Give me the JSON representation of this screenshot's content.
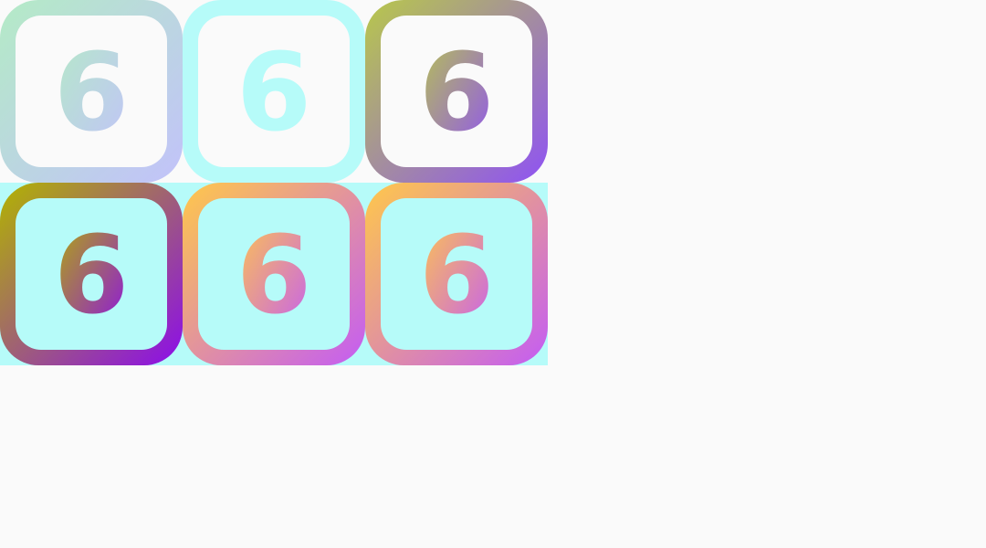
{
  "colors": {
    "page_background": "#fafafa",
    "row_backgrounds": [
      "#fafafa",
      "#b6fbf9"
    ],
    "tile_fill": "#fafafa",
    "tile_fill_dark": "#b6fbf9"
  },
  "tiles": [
    {
      "label": "6",
      "icon": "digit-six-icon",
      "gradient": [
        "#b4ebc6",
        "#c2c2fa"
      ]
    },
    {
      "label": "6",
      "icon": "digit-six-icon",
      "gradient": [
        "#b6fbf9",
        "#b6fbf9"
      ]
    },
    {
      "label": "6",
      "icon": "digit-six-icon",
      "gradient": [
        "#b8c84a",
        "#8f52f4"
      ]
    },
    {
      "label": "6",
      "icon": "digit-six-icon",
      "gradient": [
        "#b2b400",
        "#8c0ceb"
      ]
    },
    {
      "label": "6",
      "icon": "digit-six-icon",
      "gradient": [
        "#ffc84a",
        "#c45cf4"
      ]
    },
    {
      "label": "6",
      "icon": "digit-six-icon",
      "gradient": [
        "#ffc84a",
        "#c45cf4"
      ]
    }
  ]
}
